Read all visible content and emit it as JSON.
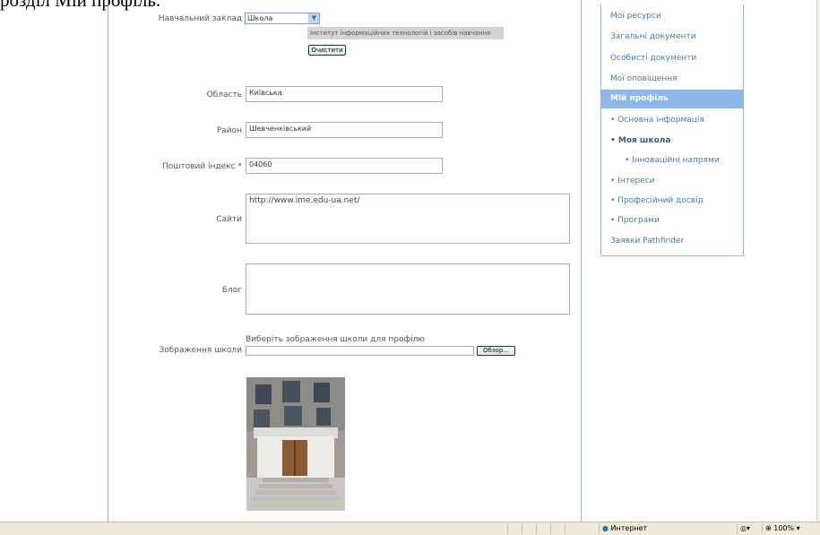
{
  "caption": "розділ Мій профіль.",
  "form": {
    "school_label": "Навчальний заклад",
    "school_select_value": "Школа",
    "school_name": "Інститут інформаційних технологій і засобів навчання",
    "clear_button": "Очистити",
    "region_label": "Область",
    "region_value": "Київська",
    "district_label": "Район",
    "district_value": "Шевченківський",
    "postal_label": "Поштовий індекс *",
    "postal_value": "04060",
    "sites_label": "Сайти",
    "sites_value": "http://www.ime.edu-ua.net/",
    "blog_label": "Блог",
    "blog_value": "",
    "image_label": "Зображення школи",
    "image_hint": "Виберіть зображення школи для профілю",
    "browse_button": "Обзор...",
    "image_alt": "school building photo"
  },
  "menu": {
    "items": [
      {
        "label": "Мої ресурси"
      },
      {
        "label": "Загальні документи"
      },
      {
        "label": "Особисті документи"
      },
      {
        "label": "Мої оповіщення"
      },
      {
        "label": "Мій профіль"
      },
      {
        "label": "• Основна інформація"
      },
      {
        "label": "• Моя школа"
      },
      {
        "label": "• Інноваційні напрями"
      },
      {
        "label": "• Інтереси"
      },
      {
        "label": "• Професійний досвід"
      },
      {
        "label": "• Програми"
      },
      {
        "label": "Заявки Pathfinder"
      }
    ]
  },
  "statusbar": {
    "zone": "Интернет",
    "zoom": "100%"
  },
  "colors": {
    "menu_active_bg": "#8cb7e6",
    "menu_link": "#4a7aa9",
    "border": "#8fb0d3"
  }
}
